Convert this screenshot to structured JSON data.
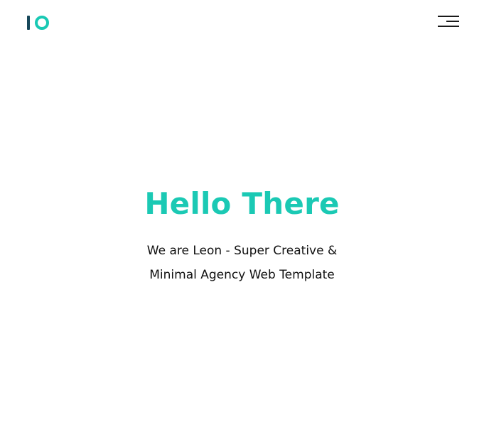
{
  "header": {
    "logo": {
      "name": "logo-io",
      "colors": {
        "bar": "#17485a",
        "ring": "#19c9b4"
      }
    },
    "menu_icon": "hamburger-menu-icon"
  },
  "hero": {
    "title": "Hello There",
    "subtitle_line1": "We are Leon - Super Creative &",
    "subtitle_line2": "Minimal Agency Web Template"
  },
  "colors": {
    "accent": "#1bc9b4",
    "text": "#111111",
    "background": "#ffffff"
  }
}
